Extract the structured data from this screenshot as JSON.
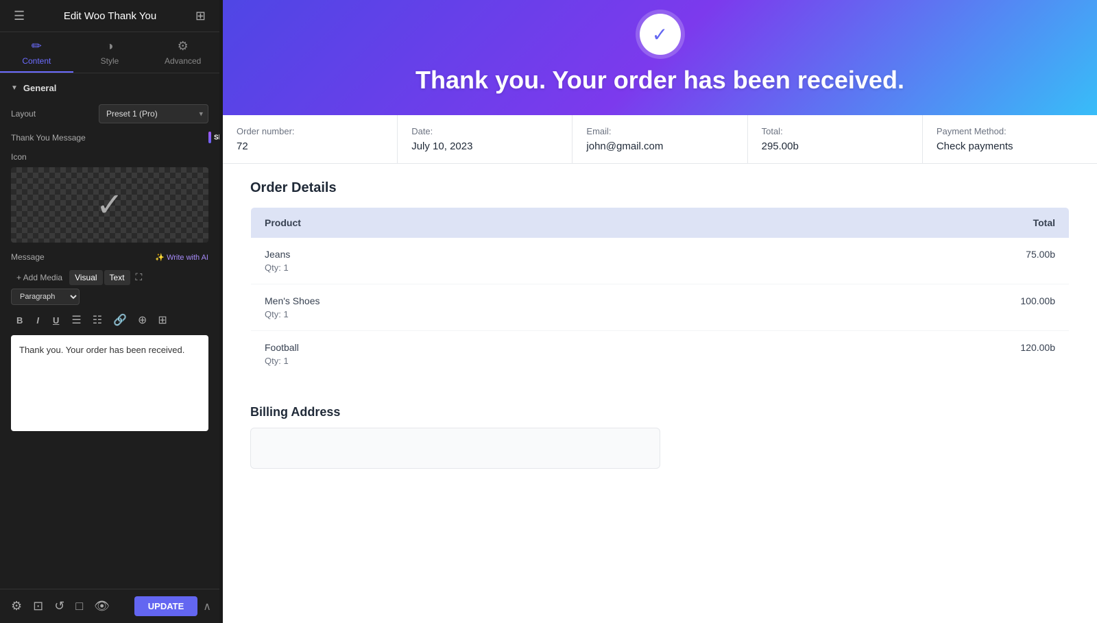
{
  "header": {
    "title": "Edit Woo Thank You",
    "hamburger_label": "☰",
    "grid_label": "⊞"
  },
  "tabs": [
    {
      "id": "content",
      "label": "Content",
      "icon": "✏️",
      "active": true
    },
    {
      "id": "style",
      "label": "Style",
      "icon": "🎨",
      "active": false
    },
    {
      "id": "advanced",
      "label": "Advanced",
      "icon": "⚙️",
      "active": false
    }
  ],
  "general_section": {
    "label": "General",
    "layout_label": "Layout",
    "layout_value": "Preset 1 (Pro)"
  },
  "thank_you_message": {
    "label": "Thank You Message",
    "toggle_text": "Show"
  },
  "icon_section": {
    "label": "Icon"
  },
  "message_section": {
    "label": "Message",
    "write_ai_label": "✨ Write with AI",
    "visual_tab": "Visual",
    "text_tab": "Text",
    "paragraph_option": "Paragraph",
    "content": "Thank you. Your order has been received."
  },
  "editor_toolbar": {
    "bold": "B",
    "italic": "I",
    "underline": "U",
    "list_unordered": "≡",
    "list_ordered": "≡",
    "link": "🔗",
    "special": "⊕",
    "table": "⊞"
  },
  "bottom_toolbar": {
    "update_label": "UPDATE",
    "settings_icon": "⚙",
    "layers_icon": "⊡",
    "history_icon": "↺",
    "responsive_icon": "□",
    "eye_icon": "👁",
    "chevron_icon": "∧"
  },
  "preview": {
    "hero": {
      "title": "Thank you. Your order has been received."
    },
    "order_info": [
      {
        "label": "Order number:",
        "value": "72"
      },
      {
        "label": "Date:",
        "value": "July 10, 2023"
      },
      {
        "label": "Email:",
        "value": "john@gmail.com"
      },
      {
        "label": "Total:",
        "value": "295.00b"
      },
      {
        "label": "Payment Method:",
        "value": "Check payments"
      }
    ],
    "order_details_title": "Order Details",
    "table_headers": [
      "Product",
      "Total"
    ],
    "products": [
      {
        "name": "Jeans",
        "qty": "Qty: 1",
        "total": "75.00b"
      },
      {
        "name": "Men's Shoes",
        "qty": "Qty: 1",
        "total": "100.00b"
      },
      {
        "name": "Football",
        "qty": "Qty: 1",
        "total": "120.00b"
      }
    ],
    "billing_title": "Billing Address"
  }
}
